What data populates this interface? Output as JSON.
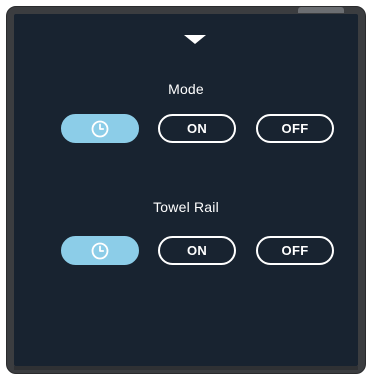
{
  "collapse_arrow": {
    "icon": "triangle-down-icon"
  },
  "mode": {
    "title": "Mode",
    "schedule_icon": "clock-icon",
    "on_label": "ON",
    "off_label": "OFF",
    "selected": "schedule"
  },
  "towel_rail": {
    "title": "Towel Rail",
    "schedule_icon": "clock-icon",
    "on_label": "ON",
    "off_label": "OFF",
    "selected": "schedule"
  },
  "colors": {
    "screen_background": "#182330",
    "active_button": "#8ccde8",
    "text": "#ffffff",
    "bezel": "#3b3d40"
  }
}
